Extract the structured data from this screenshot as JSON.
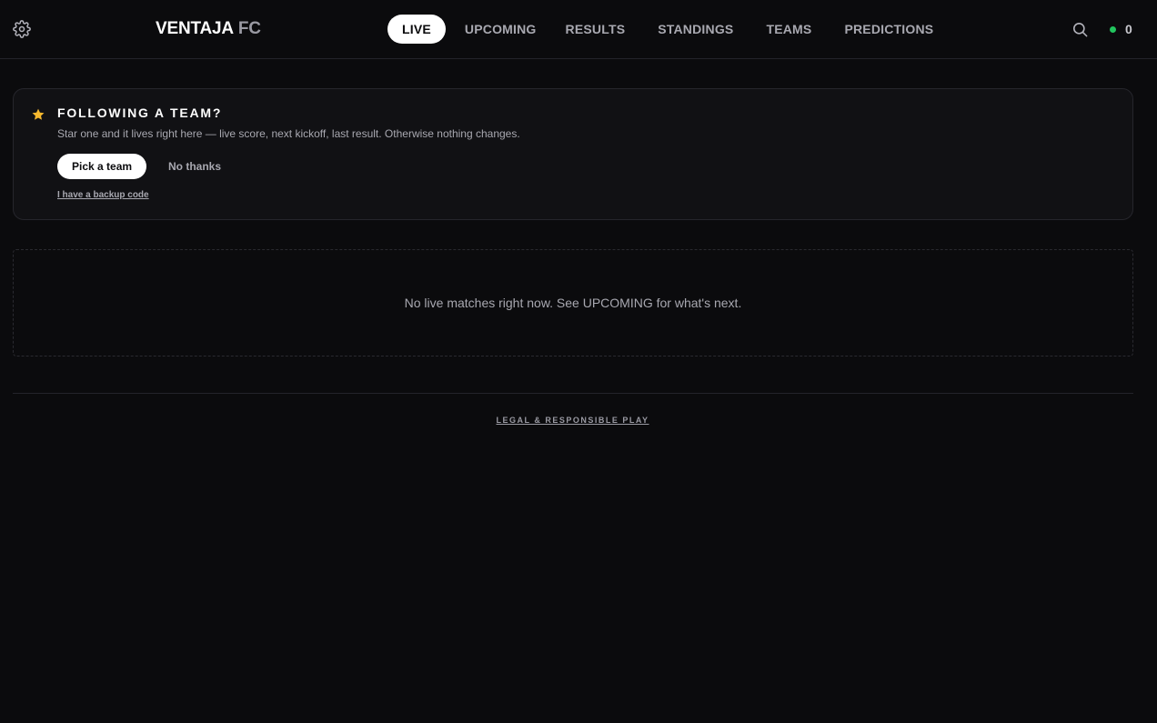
{
  "header": {
    "logo": {
      "main": "VENTAJA",
      "accent": "FC"
    },
    "tabs": [
      {
        "label": "LIVE",
        "active": true
      },
      {
        "label": "UPCOMING",
        "active": false
      },
      {
        "label": "RESULTS",
        "active": false
      },
      {
        "label": "STANDINGS",
        "active": false
      },
      {
        "label": "TEAMS",
        "active": false
      },
      {
        "label": "PREDICTIONS",
        "active": false
      }
    ],
    "status_count": "0",
    "status_color": "#22c55e",
    "icons": {
      "settings": "gear-icon",
      "search": "search-icon"
    }
  },
  "follow_card": {
    "icon": "star-icon",
    "icon_color": "#f5b82e",
    "title": "FOLLOWING A TEAM?",
    "description": "Star one and it lives right here — live score, next kickoff, last result. Otherwise nothing changes.",
    "primary_button": "Pick a team",
    "secondary_button": "No thanks",
    "backup_link": "I have a backup code"
  },
  "empty_state": {
    "message": "No live matches right now. See UPCOMING for what's next."
  },
  "footer": {
    "link": "LEGAL & RESPONSIBLE PLAY"
  }
}
